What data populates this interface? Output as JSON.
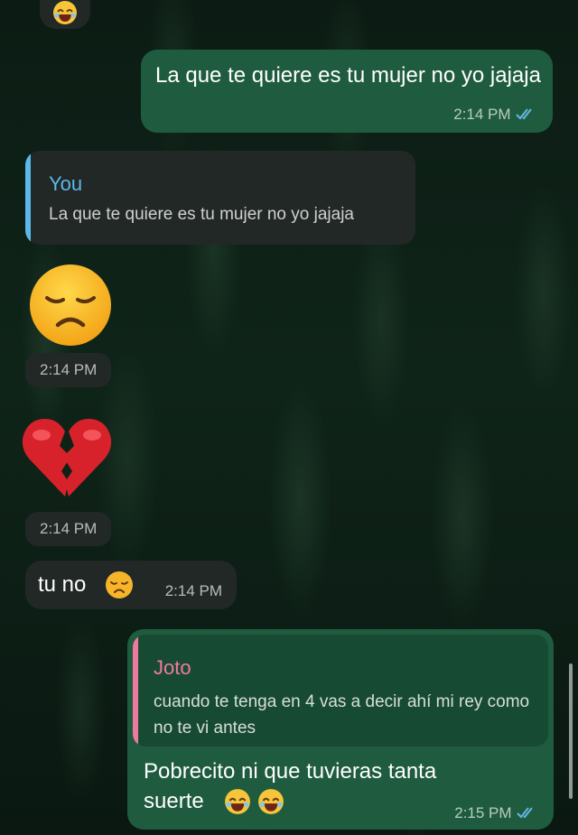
{
  "messages": {
    "m1": {
      "text": "La que te quiere es tu mujer no yo jajaja",
      "time": "2:14 PM"
    },
    "quote_card": {
      "author": "You",
      "text": "La que te quiere es tu mujer no yo jajaja"
    },
    "sticker_sad": {
      "time": "2:14 PM",
      "icon": "disappointed-face-emoji"
    },
    "sticker_heart": {
      "time": "2:14 PM",
      "icon": "broken-heart-emoji"
    },
    "m_tuno": {
      "text": "tu no",
      "time": "2:14 PM"
    },
    "m_last": {
      "quote_author": "Joto",
      "quote_text": "cuando te tenga en 4 vas a decir ahí mi rey como no te vi antes",
      "text_line1": "Pobrecito ni que tuvieras tanta",
      "text_line2": "suerte",
      "time": "2:15 PM"
    }
  },
  "colors": {
    "outgoing_bubble": "#1f5c3f",
    "incoming_bubble": "#222826",
    "quote_you": "#5bb8e9",
    "quote_joto": "#ef7aa0",
    "read_ticks": "#63b7e8"
  }
}
